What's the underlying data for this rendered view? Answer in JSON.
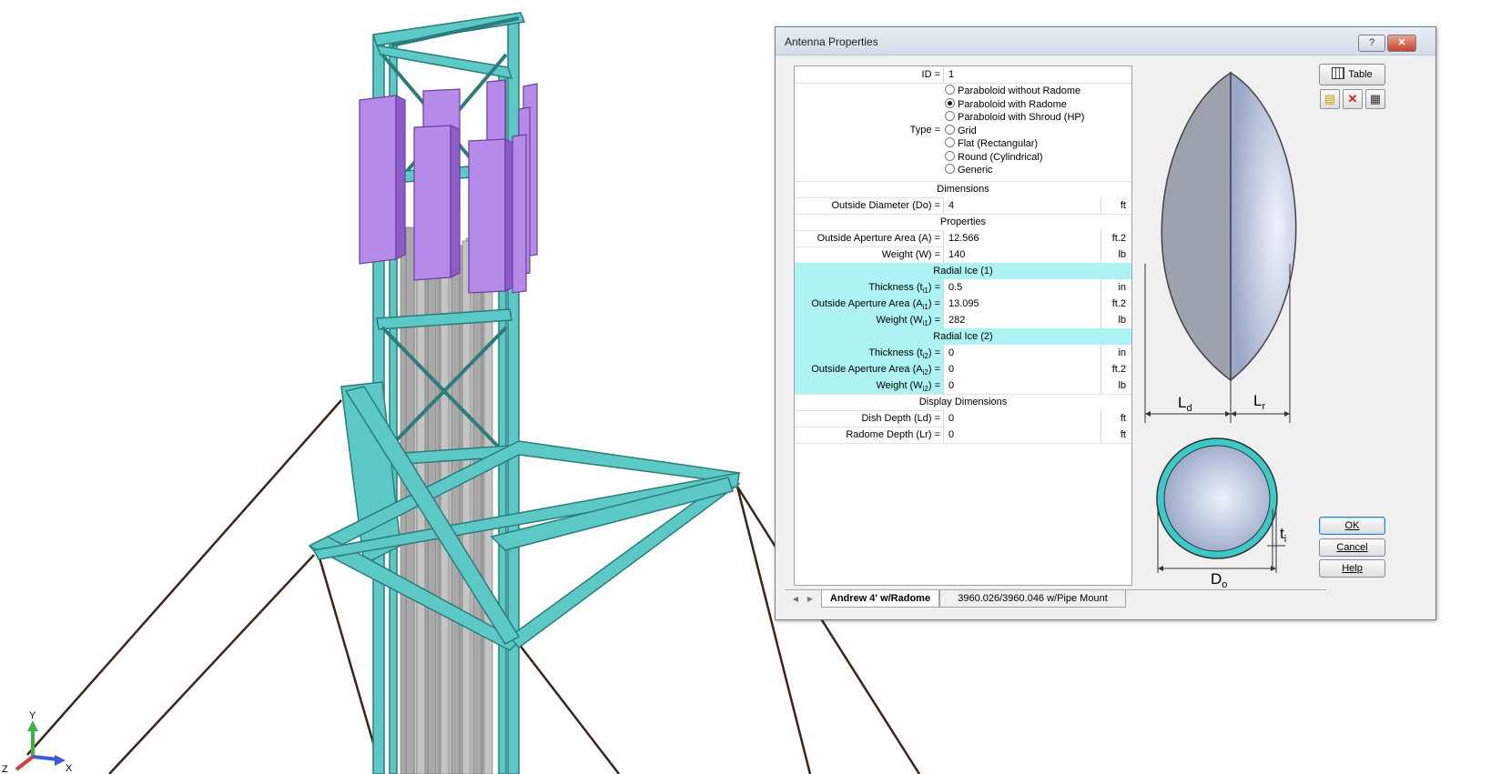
{
  "dialog": {
    "title": "Antenna Properties",
    "help_glyph": "?",
    "close_glyph": "✕"
  },
  "grid": {
    "id_label": "ID =",
    "id_value": "1",
    "type_label": "Type =",
    "type_options": [
      "Paraboloid without Radome",
      "Paraboloid with Radome",
      "Paraboloid with Shroud (HP)",
      "Grid",
      "Flat (Rectangular)",
      "Round (Cylindrical)",
      "Generic"
    ],
    "type_selected": "Paraboloid with Radome",
    "dimensions_header": "Dimensions",
    "outside_diameter_label": "Outside Diameter (Do) =",
    "outside_diameter_value": "4",
    "outside_diameter_unit": "ft",
    "properties_header": "Properties",
    "aperture_label": "Outside Aperture Area (A) =",
    "aperture_value": "12.566",
    "aperture_unit": "ft.2",
    "weight_label": "Weight (W) =",
    "weight_value": "140",
    "weight_unit": "lb",
    "ice1_header": "Radial Ice (1)",
    "ice1_thickness_pre": "Thickness (t",
    "ice1_thickness_sub": "i1",
    "ice1_thickness_post": ") =",
    "ice1_thickness_value": "0.5",
    "ice1_thickness_unit": "in",
    "ice1_aperture_pre": "Outside Aperture Area (A",
    "ice1_aperture_sub": "i1",
    "ice1_aperture_post": ") =",
    "ice1_aperture_value": "13.095",
    "ice1_aperture_unit": "ft.2",
    "ice1_weight_pre": "Weight (W",
    "ice1_weight_sub": "i1",
    "ice1_weight_post": ") =",
    "ice1_weight_value": "282",
    "ice1_weight_unit": "lb",
    "ice2_header": "Radial Ice (2)",
    "ice2_thickness_pre": "Thickness (t",
    "ice2_thickness_sub": "i2",
    "ice2_thickness_post": ") =",
    "ice2_thickness_value": "0",
    "ice2_thickness_unit": "in",
    "ice2_aperture_pre": "Outside Aperture Area (A",
    "ice2_aperture_sub": "i2",
    "ice2_aperture_post": ") =",
    "ice2_aperture_value": "0",
    "ice2_aperture_unit": "ft.2",
    "ice2_weight_pre": "Weight (W",
    "ice2_weight_sub": "i2",
    "ice2_weight_post": ") =",
    "ice2_weight_value": "0",
    "ice2_weight_unit": "lb",
    "display_header": "Display Dimensions",
    "dish_depth_label": "Dish Depth (Ld) =",
    "dish_depth_value": "0",
    "dish_depth_unit": "ft",
    "radome_depth_label": "Radome Depth (Lr) =",
    "radome_depth_value": "0",
    "radome_depth_unit": "ft"
  },
  "diagram": {
    "ld_main": "L",
    "ld_sub": "d",
    "lr_main": "L",
    "lr_sub": "r",
    "ti_main": "t",
    "ti_sub": "i",
    "do_main": "D",
    "do_sub": "o"
  },
  "buttons": {
    "table": "Table",
    "ok": "OK",
    "cancel": "Cancel",
    "help": "Help"
  },
  "tabs": {
    "nav_prev": "◀",
    "nav_next": "▶",
    "active": "Andrew 4' w/Radome",
    "inactive": "3960.026/3960.046 w/Pipe Mount"
  },
  "axes": {
    "y": "Y",
    "x": "X",
    "z": "Z"
  },
  "colors": {
    "tower_steel": "#5cc9c6",
    "tower_edge": "#2a7d7a",
    "antenna_panel": "#a974e0",
    "cable": "#b8b8b8",
    "guy_wire": "#3b2418",
    "ice_highlight": "#aef3f3"
  }
}
